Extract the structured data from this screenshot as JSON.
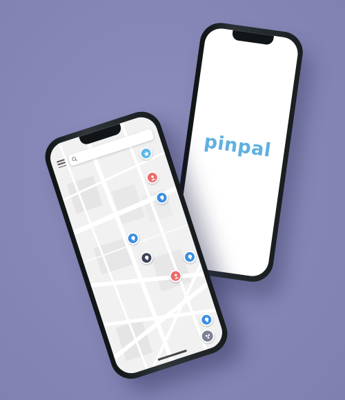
{
  "splash": {
    "logo_text": "pinpal",
    "brand_color": "#5fb0e0"
  },
  "map_screen": {
    "menu_icon": "hamburger-menu-icon",
    "search_icon": "magnifier-icon",
    "pins": [
      {
        "name": "star-pin",
        "color": "#5bb8e8",
        "icon": "star-icon"
      },
      {
        "name": "red-pin",
        "color": "#ee6a6a",
        "icon": "person-icon"
      },
      {
        "name": "blue-pin",
        "color": "#3b8fe0",
        "icon": "location-icon"
      },
      {
        "name": "blue-pin",
        "color": "#3b8fe0",
        "icon": "location-icon"
      },
      {
        "name": "dark-pin",
        "color": "#3d4357",
        "icon": "location-icon"
      },
      {
        "name": "blue-pin",
        "color": "#3b8fe0",
        "icon": "location-icon"
      },
      {
        "name": "red-pin",
        "color": "#ee6a6a",
        "icon": "person-icon"
      },
      {
        "name": "blue-pin",
        "color": "#3b8fe0",
        "icon": "location-icon"
      },
      {
        "name": "grey-pin",
        "color": "#7c8194",
        "icon": "cluster-icon"
      }
    ]
  },
  "colors": {
    "background": "#8686b6",
    "map_base": "#f1f1f1",
    "road": "#ffffff",
    "block": "#e4e4e4"
  }
}
